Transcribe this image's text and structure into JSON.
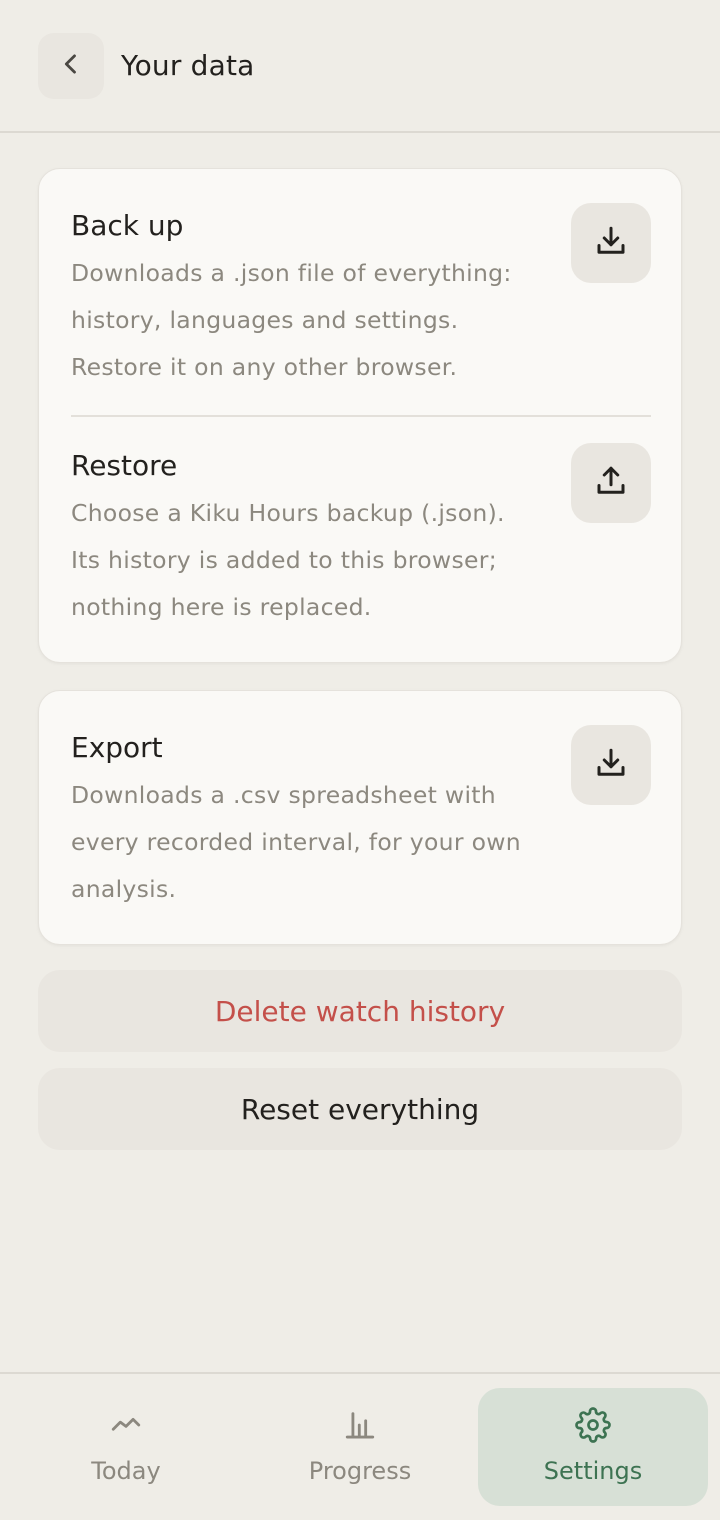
{
  "header": {
    "title": "Your data",
    "back_icon": "chevron-left-icon"
  },
  "backup": {
    "title": "Back up",
    "desc_lines": [
      "Downloads a .json file of everything:",
      "history, languages and settings.",
      "Restore it on any other browser."
    ],
    "icon": "download-icon"
  },
  "restore": {
    "title": "Restore",
    "desc_lines": [
      "Choose a Kiku Hours backup (.json).",
      "Its history is added to this browser;",
      "nothing here is replaced."
    ],
    "icon": "upload-icon"
  },
  "export": {
    "title": "Export",
    "desc_lines": [
      "Downloads a .csv spreadsheet with",
      "every recorded interval, for your own",
      "analysis."
    ],
    "icon": "download-icon"
  },
  "actions": {
    "delete_label": "Delete watch history",
    "reset_label": "Reset everything"
  },
  "nav": {
    "items": [
      {
        "label": "Today",
        "icon": "trend-line-icon",
        "active": false
      },
      {
        "label": "Progress",
        "icon": "bar-chart-icon",
        "active": false
      },
      {
        "label": "Settings",
        "icon": "gear-icon",
        "active": true
      }
    ]
  },
  "colors": {
    "background": "#efede7",
    "card": "#faf9f6",
    "danger": "#c4504a",
    "accent": "#3d7352",
    "accent_bg": "#d7e0d6",
    "muted_text": "#8c887f"
  }
}
